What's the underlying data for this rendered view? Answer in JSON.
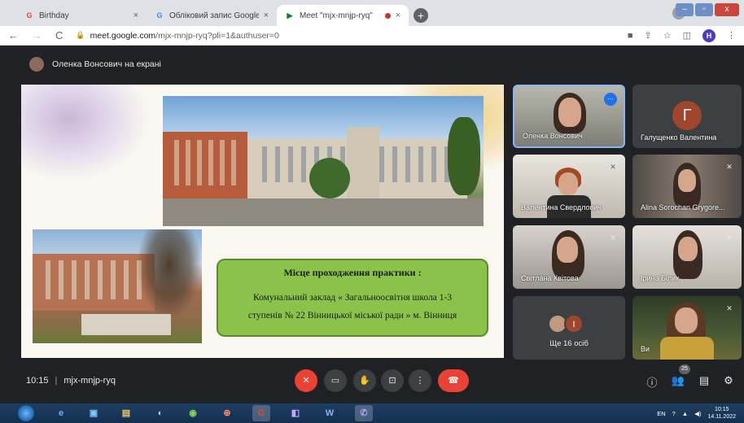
{
  "browser": {
    "tabs": [
      {
        "label": "Birthday",
        "favicon": "G"
      },
      {
        "label": "Обліковий запис Google",
        "favicon": "G"
      },
      {
        "label": "Meet \"mjx-mnjp-ryq\"",
        "favicon": "▶"
      }
    ],
    "new_tab": "+",
    "window_buttons": {
      "minimize": "–",
      "restore": "▫",
      "close": "x"
    },
    "profile": "▾",
    "nav": {
      "back": "←",
      "forward": "→",
      "reload": "C"
    },
    "url": {
      "host": "meet.google.com",
      "path": "/mjx-mnjp-ryq?pli=1&authuser=0"
    },
    "toolbar_icons": [
      "video-camera-icon",
      "share-icon",
      "star-icon",
      "sidebar-icon"
    ],
    "avatar_letter": "H",
    "menu": "⋮"
  },
  "meet": {
    "presenter_label": "Оленка Вонсович на екрані",
    "slide": {
      "title": "Місце проходження практики",
      "title_suffix": ":",
      "line1": "Комунальний заклад « Загальноосвітня школа 1-3",
      "line2": "ступенів № 22 Вінницької міської ради » м. Вінниця"
    },
    "participants": [
      {
        "name": "Оленка Вонсович",
        "status": "speaking"
      },
      {
        "name": "Галущенко Валентина",
        "letter": "Г"
      },
      {
        "name": "Валентина Свердлович",
        "status": "muted"
      },
      {
        "name": "Alina Sorochan Grygore...",
        "status": "muted"
      },
      {
        "name": "Світлана Квітова",
        "status": "muted"
      },
      {
        "name": "Ірина Білик",
        "status": "muted"
      },
      {
        "more_label": "Ще 16 осіб",
        "letter": "І"
      },
      {
        "name": "Ви",
        "status": "muted"
      }
    ],
    "bottom": {
      "time": "10:15",
      "separator": "|",
      "meeting_code": "mjx-mnjp-ryq",
      "participants_count": "25"
    }
  },
  "taskbar": {
    "apps": [
      "e",
      "▣",
      "▤",
      "◐",
      "◉",
      "⊕",
      "G",
      "◧",
      "W",
      "✆"
    ],
    "lang": "EN",
    "time": "10:15",
    "date": "14.11.2022"
  },
  "colors": {
    "meet_bg": "#202124",
    "end_call": "#ea4335",
    "slide_box": "#8bc34a",
    "active_tile": "#8ab4f8"
  }
}
